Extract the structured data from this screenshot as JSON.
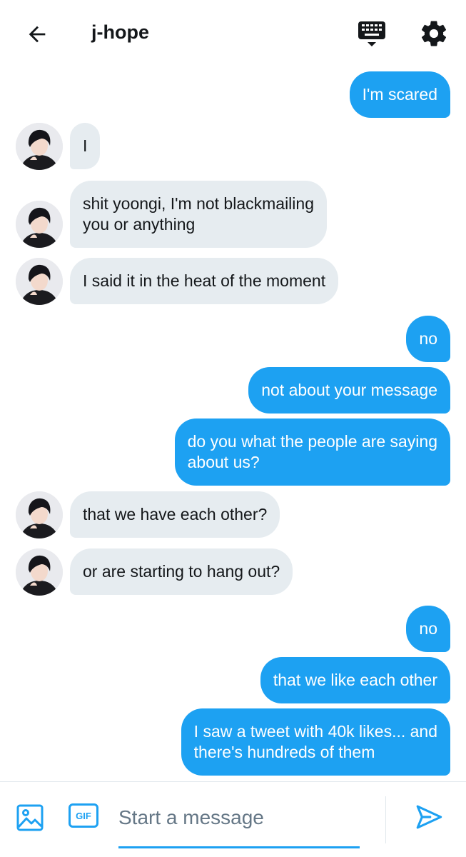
{
  "header": {
    "title": "j-hope",
    "back_icon": "arrow-left-icon",
    "keyboard_icon": "keyboard-icon",
    "settings_icon": "gear-icon"
  },
  "colors": {
    "accent": "#1da1f2",
    "incoming_bubble": "#e6ecf0",
    "text": "#14171a",
    "placeholder": "#657786"
  },
  "messages": [
    {
      "dir": "out",
      "lines": [
        "I'm scared"
      ]
    },
    {
      "dir": "in",
      "lines": [
        "I"
      ]
    },
    {
      "dir": "in",
      "lines": [
        "shit yoongi, I'm not blackmailing",
        "you or anything"
      ]
    },
    {
      "dir": "in",
      "lines": [
        "I said it in the heat of the moment"
      ]
    },
    {
      "dir": "out",
      "lines": [
        "no"
      ]
    },
    {
      "dir": "out",
      "lines": [
        "not about your message"
      ]
    },
    {
      "dir": "out",
      "lines": [
        "do you what the people are saying",
        "about us?"
      ]
    },
    {
      "dir": "in",
      "lines": [
        "that we have each other?"
      ]
    },
    {
      "dir": "in",
      "lines": [
        "or are starting to hang out?"
      ]
    },
    {
      "dir": "out",
      "lines": [
        "no"
      ]
    },
    {
      "dir": "out",
      "lines": [
        "that we like each other"
      ]
    },
    {
      "dir": "out",
      "lines": [
        "I saw a tweet with 40k likes... and",
        "there's hundreds of them"
      ]
    }
  ],
  "composer": {
    "placeholder": "Start a message",
    "gif_label": "GIF",
    "image_icon": "image-icon",
    "send_icon": "send-icon"
  }
}
